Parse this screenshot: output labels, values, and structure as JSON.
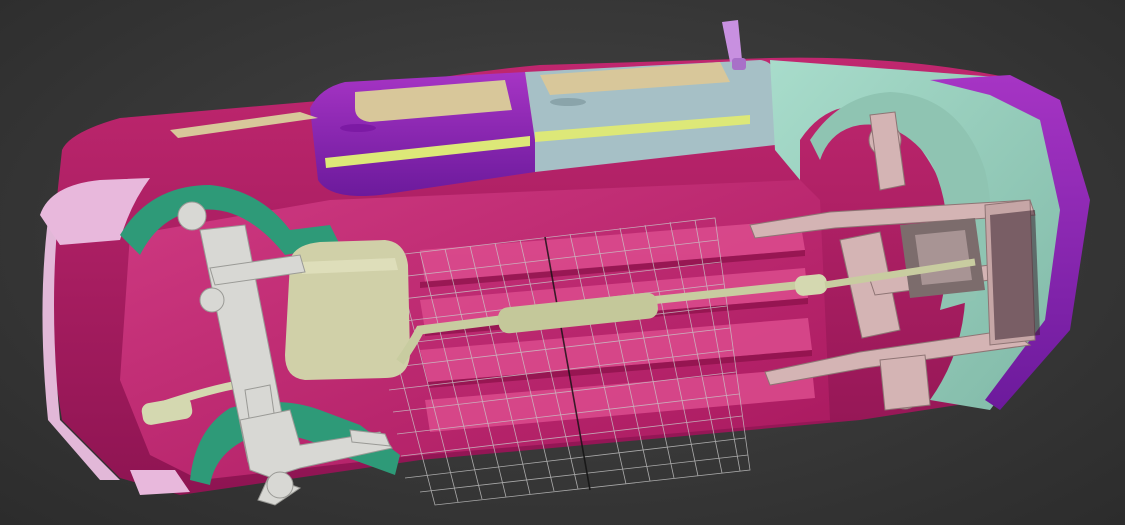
{
  "viewport": {
    "background": "#3a3a3a",
    "model": "car-undercarriage-3d",
    "render_mode": "shaded"
  },
  "colors": {
    "body_magenta": "#b01f6a",
    "floor_magenta": "#c8307a",
    "floor_light": "#d84a8c",
    "door_purple": "#9a22b8",
    "door_blue": "#a6c0c6",
    "fender_mint": "#9ed3c0",
    "fender_purple": "#7a1fc8",
    "wheelwell_green": "#2e9a78",
    "bumper_pink": "#e8b8dc",
    "window_tan": "#d8c79a",
    "tank_olive": "#d0d0a8",
    "exhaust_olive": "#c8cca0",
    "suspension_grey": "#d8d8d4",
    "frame_pinkgrey": "#d4b4b4",
    "mirror_violet": "#c890e0",
    "stripe_yellow": "#dde878",
    "grid_line": "#c8c8c8"
  },
  "objects": [
    {
      "name": "car-body",
      "icon": "car-icon"
    },
    {
      "name": "fuel-tank",
      "icon": "tank-icon"
    },
    {
      "name": "exhaust-system",
      "icon": "pipe-icon"
    },
    {
      "name": "front-subframe",
      "icon": "frame-icon"
    },
    {
      "name": "rear-axle",
      "icon": "axle-icon"
    },
    {
      "name": "construction-grid",
      "icon": "grid-icon"
    }
  ]
}
